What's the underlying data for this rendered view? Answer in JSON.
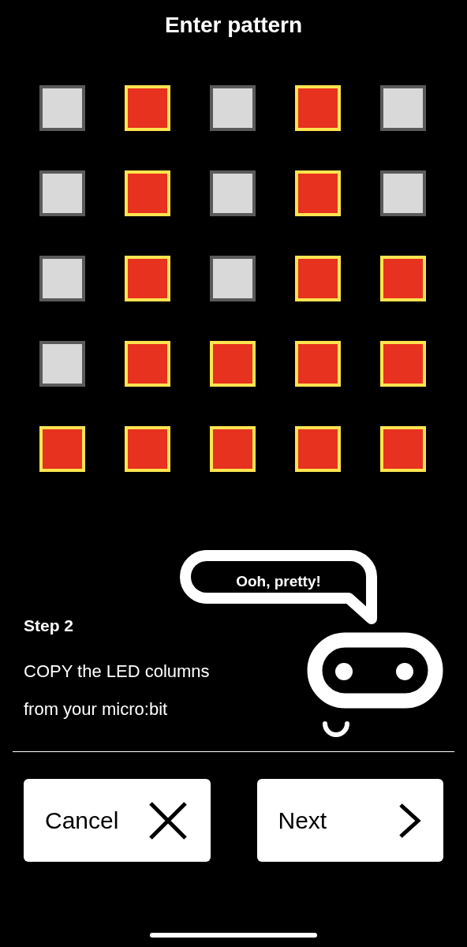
{
  "title": "Enter pattern",
  "grid": [
    [
      {
        "on": false
      },
      {
        "on": true
      },
      {
        "on": false
      },
      {
        "on": true
      },
      {
        "on": false
      }
    ],
    [
      {
        "on": false
      },
      {
        "on": true
      },
      {
        "on": false
      },
      {
        "on": true
      },
      {
        "on": false
      }
    ],
    [
      {
        "on": false
      },
      {
        "on": true
      },
      {
        "on": false
      },
      {
        "on": true
      },
      {
        "on": true
      }
    ],
    [
      {
        "on": false
      },
      {
        "on": true
      },
      {
        "on": true
      },
      {
        "on": true
      },
      {
        "on": true
      }
    ],
    [
      {
        "on": true
      },
      {
        "on": true
      },
      {
        "on": true
      },
      {
        "on": true
      },
      {
        "on": true
      }
    ]
  ],
  "bubble": "Ooh, pretty!",
  "step": {
    "heading": "Step 2",
    "lines": [
      "COPY the LED columns",
      "from your micro:bit"
    ]
  },
  "buttons": [
    {
      "label": "Cancel",
      "kind": "cancel"
    },
    {
      "label": "Next",
      "kind": "next"
    }
  ]
}
